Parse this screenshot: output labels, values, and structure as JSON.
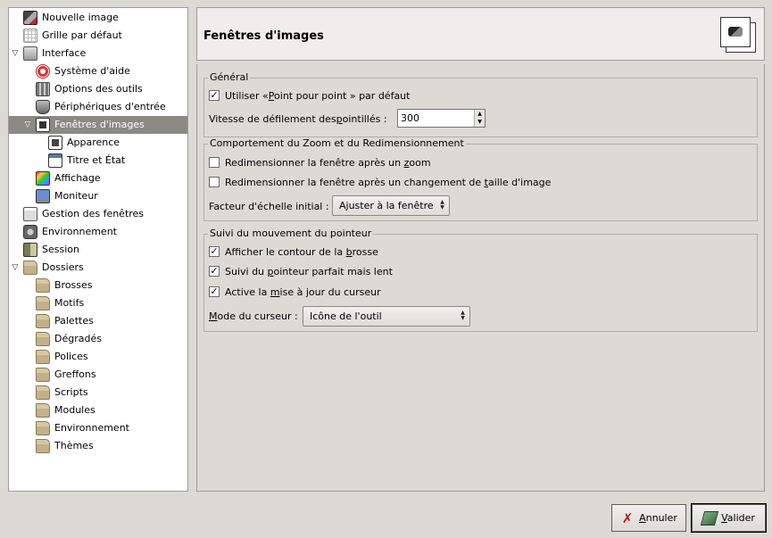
{
  "tree": {
    "items": [
      {
        "label": "Nouvelle image",
        "icon": "new-image-icon",
        "level": 1,
        "expander": ""
      },
      {
        "label": "Grille par défaut",
        "icon": "grid-icon",
        "level": 1,
        "expander": ""
      },
      {
        "label": "Interface",
        "icon": "interface-icon",
        "level": 1,
        "expander": "▽"
      },
      {
        "label": "Système d'aide",
        "icon": "help-icon",
        "level": 2,
        "expander": ""
      },
      {
        "label": "Options des outils",
        "icon": "tool-options-icon",
        "level": 2,
        "expander": ""
      },
      {
        "label": "Périphériques d'entrée",
        "icon": "input-devices-icon",
        "level": 2,
        "expander": ""
      },
      {
        "label": "Fenêtres d'images",
        "icon": "image-windows-icon",
        "level": 2,
        "expander": "▽",
        "selected": true
      },
      {
        "label": "Apparence",
        "icon": "appearance-icon",
        "level": 3,
        "expander": ""
      },
      {
        "label": "Titre et État",
        "icon": "title-status-icon",
        "level": 3,
        "expander": ""
      },
      {
        "label": "Affichage",
        "icon": "display-icon",
        "level": 2,
        "expander": ""
      },
      {
        "label": "Moniteur",
        "icon": "monitor-icon",
        "level": 2,
        "expander": ""
      },
      {
        "label": "Gestion des fenêtres",
        "icon": "window-management-icon",
        "level": 1,
        "expander": ""
      },
      {
        "label": "Environnement",
        "icon": "environment-icon",
        "level": 1,
        "expander": ""
      },
      {
        "label": "Session",
        "icon": "session-icon",
        "level": 1,
        "expander": ""
      },
      {
        "label": "Dossiers",
        "icon": "folders-icon",
        "level": 1,
        "expander": "▽"
      },
      {
        "label": "Brosses",
        "icon": "folder-icon",
        "level": 2,
        "expander": ""
      },
      {
        "label": "Motifs",
        "icon": "folder-icon",
        "level": 2,
        "expander": ""
      },
      {
        "label": "Palettes",
        "icon": "folder-icon",
        "level": 2,
        "expander": ""
      },
      {
        "label": "Dégradés",
        "icon": "folder-icon",
        "level": 2,
        "expander": ""
      },
      {
        "label": "Polices",
        "icon": "folder-icon",
        "level": 2,
        "expander": ""
      },
      {
        "label": "Greffons",
        "icon": "folder-icon",
        "level": 2,
        "expander": ""
      },
      {
        "label": "Scripts",
        "icon": "folder-icon",
        "level": 2,
        "expander": ""
      },
      {
        "label": "Modules",
        "icon": "folder-icon",
        "level": 2,
        "expander": ""
      },
      {
        "label": "Environnement",
        "icon": "folder-icon",
        "level": 2,
        "expander": ""
      },
      {
        "label": "Thèmes",
        "icon": "folder-icon",
        "level": 2,
        "expander": ""
      }
    ]
  },
  "header": {
    "title": "Fenêtres d'images",
    "icon": "image-windows-icon"
  },
  "general": {
    "title": "Général",
    "dot_for_dot": {
      "pre": "Utiliser «",
      "mnemonic": "P",
      "post": "oint pour point » par défaut",
      "checked": true
    },
    "marching_ants": {
      "pre": "Vitesse de défilement des ",
      "mnemonic": "p",
      "post": "ointillés :",
      "value": "300"
    }
  },
  "zoom": {
    "title": "Comportement du Zoom et du Redimensionnement",
    "resize_on_zoom": {
      "pre": "Redimensionner la fenêtre après un ",
      "mnemonic": "z",
      "post": "oom",
      "checked": false
    },
    "resize_on_change": {
      "pre": "Redimensionner la fenêtre après un changement de ",
      "mnemonic": "t",
      "post": "aille d'image",
      "checked": false
    },
    "initial_zoom": {
      "label": "Facteur d'échelle initial :",
      "value": "Ajuster à la fenêtre"
    }
  },
  "pointer": {
    "title": "Suivi du mouvement du pointeur",
    "brush_outline": {
      "pre": "Afficher le contour de la ",
      "mnemonic": "b",
      "post": "rosse",
      "checked": true
    },
    "perfect_pointer": {
      "pre": "Suivi du ",
      "mnemonic": "p",
      "post": "ointeur parfait mais lent",
      "checked": true
    },
    "cursor_update": {
      "pre": "Active la ",
      "mnemonic": "m",
      "post": "ise à jour du curseur",
      "checked": true
    },
    "cursor_mode": {
      "pre": "",
      "mnemonic": "M",
      "post": "ode du curseur :",
      "value": "Icône de l'outil"
    }
  },
  "buttons": {
    "cancel": {
      "mnemonic": "A",
      "post": "nnuler"
    },
    "ok": {
      "mnemonic": "V",
      "post": "alider"
    }
  },
  "check_mark": "✓",
  "colors": {
    "selection": "#8a8983",
    "window_bg": "#dcdad5"
  }
}
